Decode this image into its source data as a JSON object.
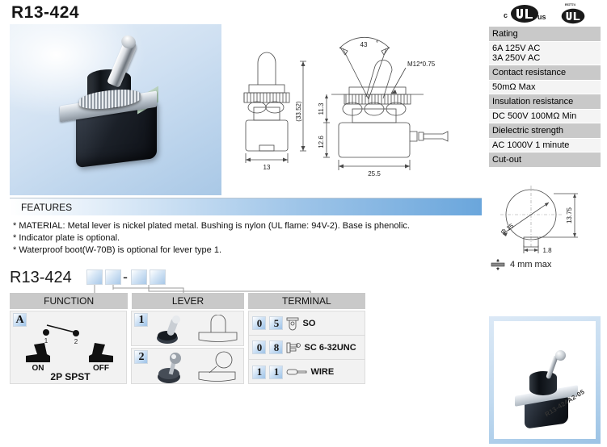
{
  "page": {
    "part_number": "R13-424"
  },
  "certifications": {
    "ul_c": "c",
    "ul_us": "us",
    "ul_file_number": "E67774",
    "marks": [
      "cULus",
      "UL"
    ]
  },
  "spec_table": {
    "rows": [
      {
        "header": "Rating",
        "value": "6A 125V AC\n3A 250V AC"
      },
      {
        "header": "Contact resistance",
        "value": "50mΩ Max"
      },
      {
        "header": "Insulation resistance",
        "value": "DC 500V 100MΩ Min"
      },
      {
        "header": "Dielectric strength",
        "value": "AC 1000V 1 minute"
      },
      {
        "header": "Cut-out",
        "value": ""
      }
    ],
    "cutout": {
      "diameter_label": "Φ 15",
      "height_label": "13.75",
      "flat_label": "1.8",
      "panel_note": "4 mm max"
    }
  },
  "drawings": {
    "front_view": {
      "width_label": "13",
      "total_height_label": "(33.52)"
    },
    "side_view": {
      "angle_label": "43",
      "angle_unit": "°",
      "thread_label": "M12*0.75",
      "bushing_height_label": "11.3",
      "body_height_label": "12.6",
      "body_width_label": "25.5"
    }
  },
  "features": {
    "title": "FEATURES",
    "items": [
      "* MATERIAL: Metal lever is nickel plated metal. Bushing is nylon (UL flame: 94V-2). Base is phenolic.",
      "* Indicator plate is optional.",
      "* Waterproof boot(W-70B) is optional for lever type 1."
    ]
  },
  "order_code": {
    "prefix": "R13-424",
    "separator": "-",
    "boxes": [
      "",
      "",
      "",
      ""
    ]
  },
  "selection_table": {
    "headers": {
      "function": "FUNCTION",
      "lever": "LEVER",
      "terminal": "TERMINAL"
    },
    "function_options": [
      {
        "code": "A",
        "circuit_label": "2P SPST",
        "pos_left": "ON",
        "pos_right": "OFF",
        "terminal_1": "1",
        "terminal_2": "2"
      }
    ],
    "lever_options": [
      {
        "code": "1"
      },
      {
        "code": "2"
      }
    ],
    "terminal_options": [
      {
        "digit1": "0",
        "digit2": "5",
        "icon": "solder-lug-icon",
        "label": "SO"
      },
      {
        "digit1": "0",
        "digit2": "8",
        "icon": "screw-terminal-icon",
        "label": "SC 6-32UNC"
      },
      {
        "digit1": "1",
        "digit2": "1",
        "icon": "wire-lead-icon",
        "label": "WIRE"
      }
    ]
  },
  "bottom_photo": {
    "caption": "R13-424A2-05"
  }
}
